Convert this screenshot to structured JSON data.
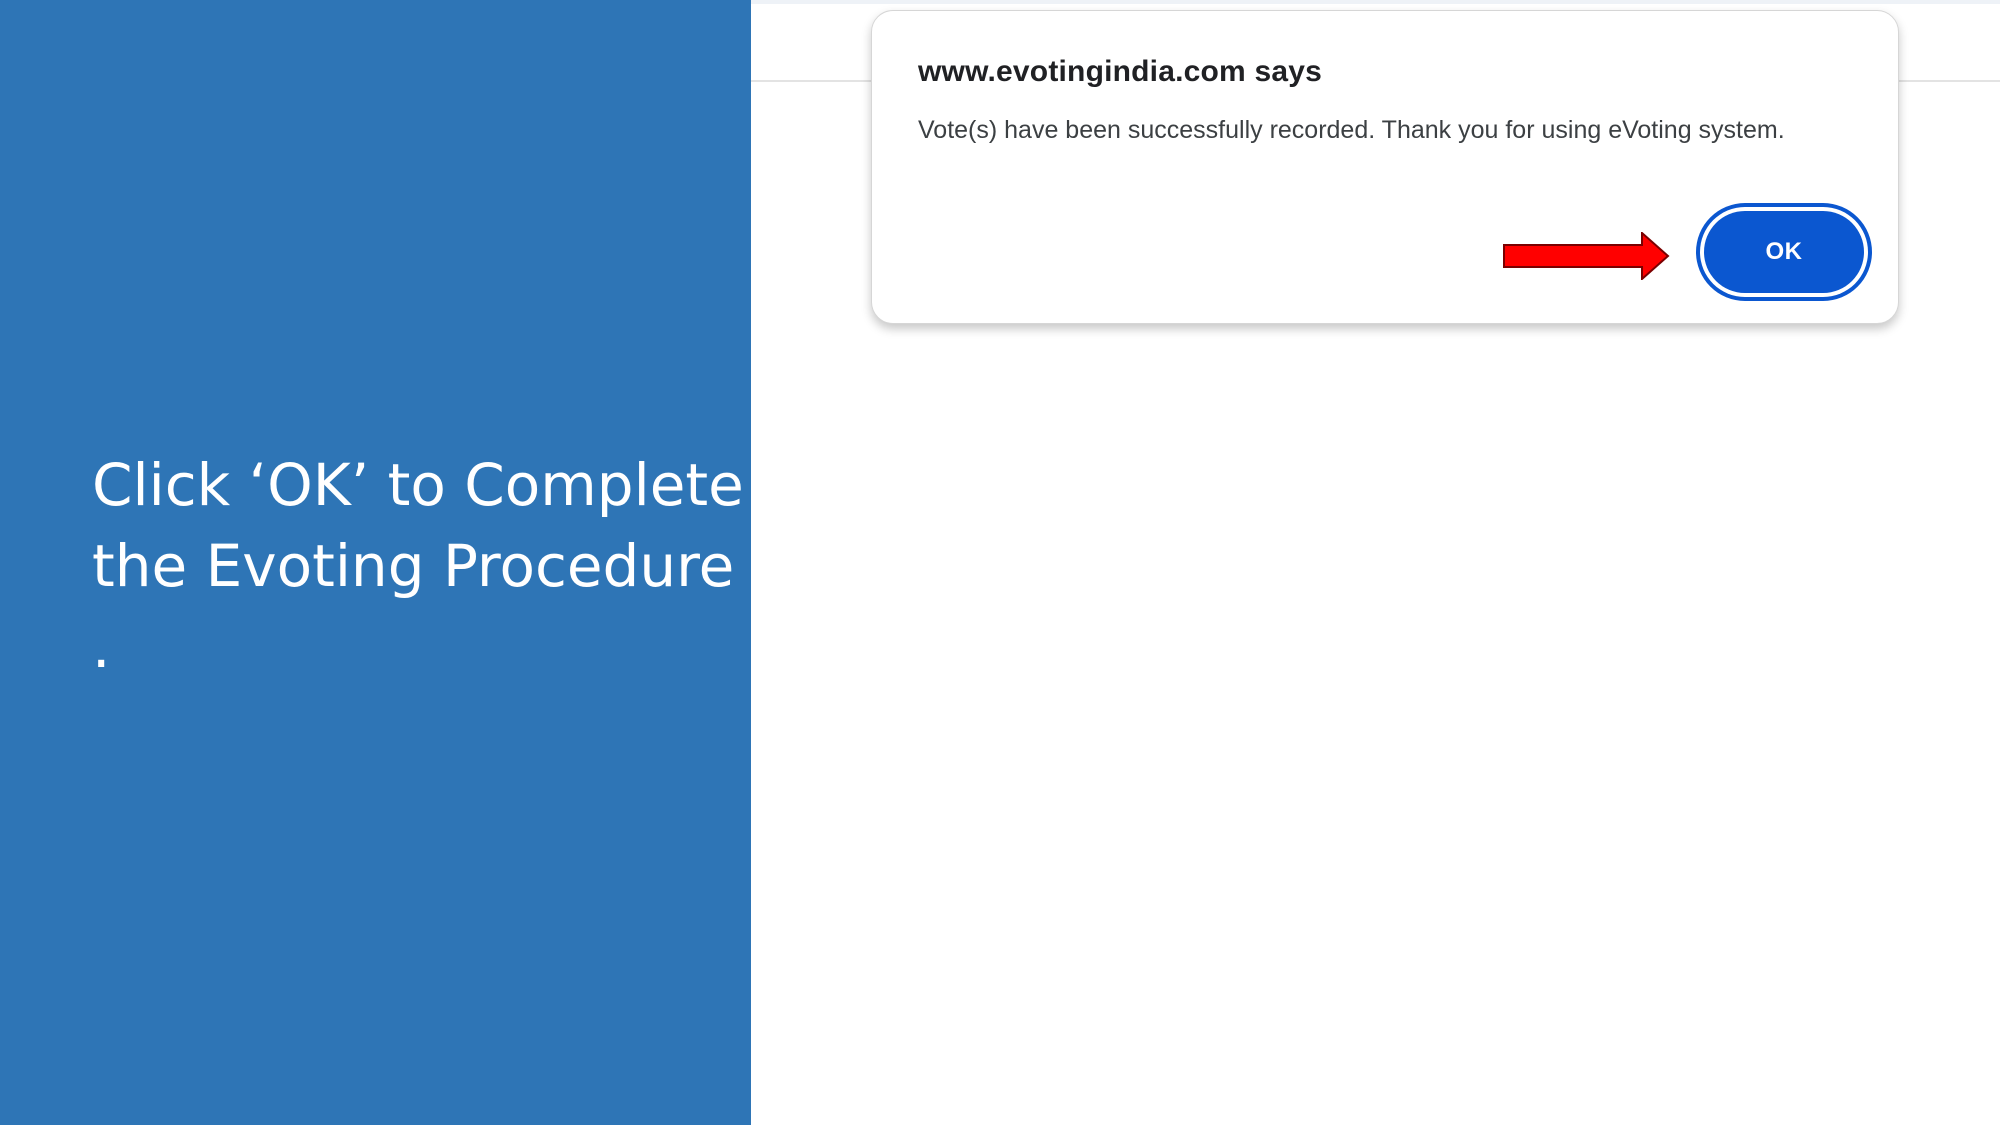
{
  "slide": {
    "instruction_lines": [
      "Click ‘OK’ to Complete",
      "the Evoting Procedure",
      "."
    ]
  },
  "dialog": {
    "title": "www.evotingindia.com says",
    "message": "Vote(s) have been successfully recorded. Thank you for using eVoting system.",
    "ok_label": "OK"
  },
  "annotation": {
    "arrow_icon": "right-arrow-icon",
    "arrow_color": "#ff0000"
  },
  "colors": {
    "panel": "#2e75b6",
    "button": "#0b57d0"
  }
}
